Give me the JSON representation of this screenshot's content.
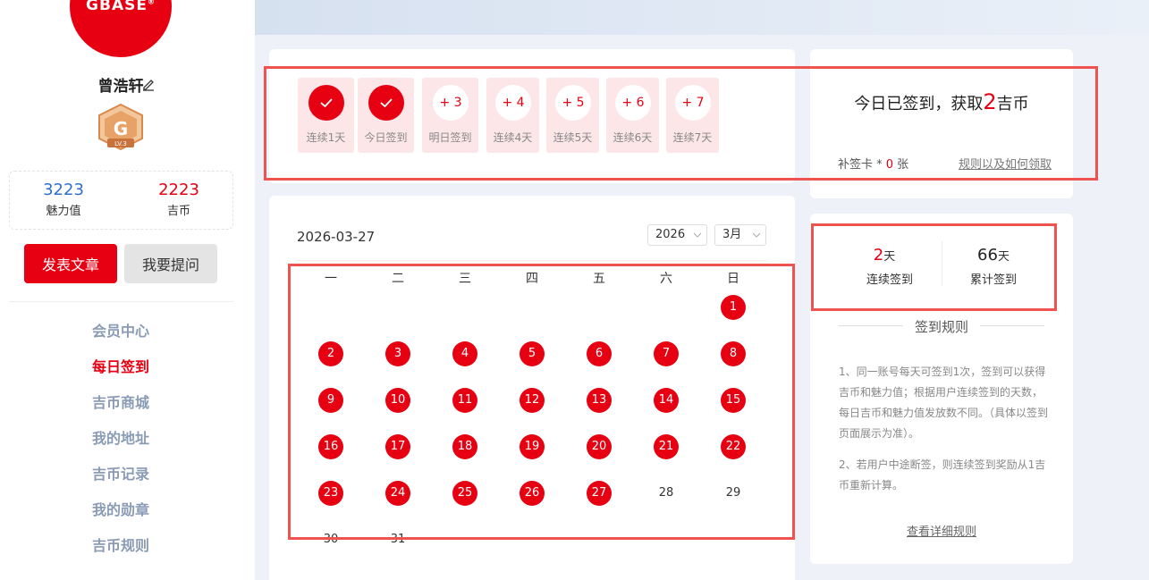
{
  "sidebar": {
    "logo_text": "GBASE",
    "logo_mark": "®",
    "username": "曾浩轩",
    "badge_level": "LV.3",
    "stats": [
      {
        "value": "3223",
        "label": "魅力值",
        "color": "#2f6fd1"
      },
      {
        "value": "2223",
        "label": "吉币",
        "color": "#e60012"
      }
    ],
    "publish_button": "发表文章",
    "ask_button": "我要提问",
    "nav": [
      {
        "label": "会员中心",
        "active": false
      },
      {
        "label": "每日签到",
        "active": true
      },
      {
        "label": "吉币商城",
        "active": false
      },
      {
        "label": "我的地址",
        "active": false
      },
      {
        "label": "吉币记录",
        "active": false
      },
      {
        "label": "我的勋章",
        "active": false
      },
      {
        "label": "吉币规则",
        "active": false
      }
    ]
  },
  "streak": {
    "days": [
      {
        "label": "连续1天",
        "done": true,
        "reward": ""
      },
      {
        "label": "今日签到",
        "done": true,
        "reward": ""
      },
      {
        "label": "明日签到",
        "done": false,
        "reward": "+ 3"
      },
      {
        "label": "连续4天",
        "done": false,
        "reward": "+ 4"
      },
      {
        "label": "连续5天",
        "done": false,
        "reward": "+ 5"
      },
      {
        "label": "连续6天",
        "done": false,
        "reward": "+ 6"
      },
      {
        "label": "连续7天",
        "done": false,
        "reward": "+ 7"
      }
    ]
  },
  "reward": {
    "prefix": "今日已签到，获取",
    "amount": "2",
    "suffix": "吉币",
    "makeup_label": "补签卡 * ",
    "makeup_count": "0",
    "makeup_unit": " 张",
    "rules_link": "规则以及如何领取"
  },
  "calendar": {
    "date": "2026-03-27",
    "year_select": "2026",
    "month_select": "3月",
    "weekdays": [
      "一",
      "二",
      "三",
      "四",
      "五",
      "六",
      "日"
    ],
    "first_weekday_index": 6,
    "days_in_month": 31,
    "signed_days": [
      1,
      2,
      3,
      4,
      5,
      6,
      7,
      8,
      9,
      10,
      11,
      12,
      13,
      14,
      15,
      16,
      17,
      18,
      19,
      20,
      21,
      22,
      23,
      24,
      25,
      26,
      27
    ]
  },
  "summary": {
    "streak_value": "2",
    "streak_unit": "天",
    "streak_label": "连续签到",
    "total_value": "66",
    "total_unit": "天",
    "total_label": "累计签到"
  },
  "rules": {
    "title": "签到规则",
    "p1": "1、同一账号每天可签到1次，签到可以获得吉币和魅力值；根据用户连续签到的天数，每日吉币和魅力值发放数不同。（具体以签到页面展示为准）。",
    "p2": "2、若用户中途断签，则连续签到奖励从1吉币重新计算。",
    "detail_link": "查看详细规则"
  },
  "colors": {
    "accent": "#e60012",
    "highlight_frame": "#ef5350",
    "nav_inactive": "#8a9bb4"
  }
}
